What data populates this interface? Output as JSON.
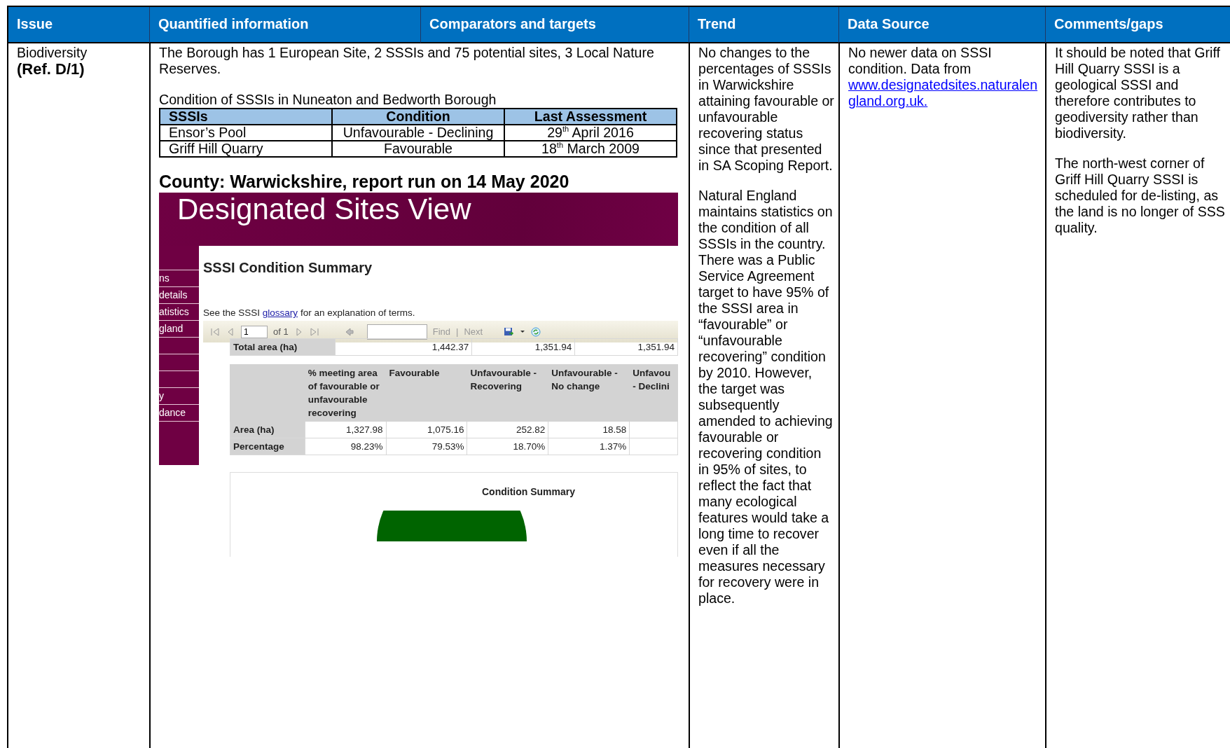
{
  "table": {
    "columns": [
      "Issue",
      "Quantified information",
      "Comparators and targets",
      "Trend",
      "Data Source",
      "Comments/gaps"
    ],
    "row": {
      "issue": "Biodiversity",
      "ref": "(Ref. D/1)",
      "quantified": {
        "intro": "The Borough has 1 European Site, 2 SSSIs and 75 potential sites, 3 Local Nature Reserves.",
        "caption": "Condition of SSSIs in Nuneaton and Bedworth Borough",
        "sssi_table": {
          "columns": [
            "SSSIs",
            "Condition",
            "Last Assessment"
          ],
          "rows": [
            {
              "site": "Ensor’s Pool",
              "condition": "Unfavourable - Declining",
              "last_assessment": "29$^{th}$ April 2016"
            },
            {
              "site": "Griff Hill Quarry",
              "condition": "Favourable",
              "last_assessment": "18$^{th}$ March 2009"
            }
          ]
        },
        "report_heading": "County: Warwickshire, report run on 14 May 2020",
        "embedded_screenshot": {
          "banner_title": "Designated Sites View",
          "nav_top": [
            "ns",
            "details",
            "atistics",
            "gland"
          ],
          "nav_bottom": [
            "y",
            "dance"
          ],
          "page_title": "SSSI Condition Summary",
          "note_before": "See the SSSI",
          "note_link": "glossary",
          "note_after": "for an explanation of terms.",
          "toolbar": {
            "page": "1",
            "of": "of 1",
            "find": "Find",
            "separator": "|",
            "next": "Next"
          },
          "total_area": {
            "label": "Total area (ha)",
            "values": [
              "1,442.37",
              "1,351.94",
              "1,351.94"
            ]
          },
          "summary": {
            "columns": [
              "% meeting area of favourable or unfavourable recovering",
              "Favourable",
              "Unfavourable - Recovering",
              "Unfavourable - No change",
              "Unfavou - Declini"
            ],
            "rows": [
              {
                "label": "Area (ha)",
                "values": [
                  "1,327.98",
                  "1,075.16",
                  "252.82",
                  "18.58"
                ]
              },
              {
                "label": "Percentage",
                "values": [
                  "98.23%",
                  "79.53%",
                  "18.70%",
                  "1.37%"
                ]
              }
            ]
          },
          "chart_title": "Condition Summary"
        }
      },
      "trend": [
        [
          "No changes to the percentages of SSSIs in Warwickshire attaining favourable or unfavourable recovering status since that presented in SA Scoping Report."
        ],
        [
          "Natural England maintains statistics on the condition of all SSSIs in the country.",
          "There was a Public Service Agreement target to have 95% of the SSSI area in “favourable” or “unfavourable recovering” condition by 2010.  However, the target was subsequently amended to achieving favourable or recovering condition in 95% of sites, to reflect the fact that many ecological features would take a long time to recover even if all the measures necessary for recovery were in place."
        ]
      ],
      "data_source": {
        "text": "No newer data on SSSI condition.  Data from",
        "link": "www.designatedsites.naturalengland.org.uk."
      },
      "comments": [
        "It should be noted that Griff Hill Quarry SSSI is a geological SSSI and therefore contributes to geodiversity rather than biodiversity.",
        "The north-west corner of Griff Hill Quarry SSSI is scheduled for de-listing, as the land is no longer of SSS quality."
      ]
    }
  }
}
